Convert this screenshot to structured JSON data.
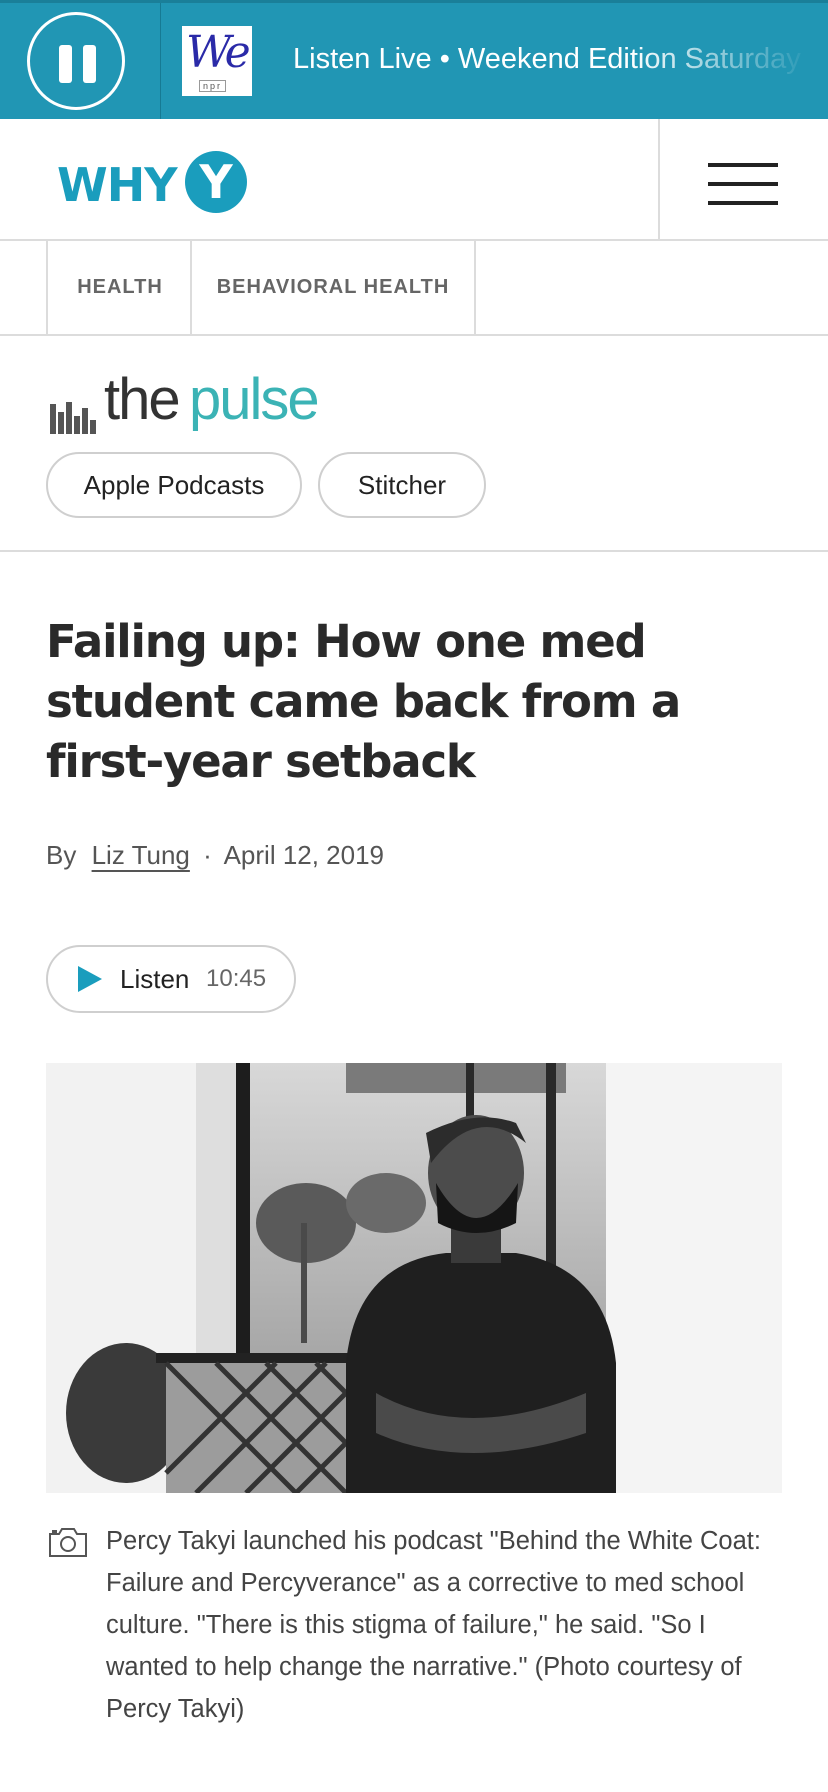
{
  "player": {
    "station_logo": "We",
    "station_sub": "npr",
    "live_text": "Listen Live • Weekend Edition Saturday",
    "pause_icon": "pause-icon"
  },
  "header": {
    "logo_text": "WHY",
    "logo_circle_letter": "Y",
    "menu_icon": "hamburger-menu-icon",
    "brand_color": "#1a9dbd"
  },
  "breadcrumb": {
    "items": [
      {
        "label": "HEALTH"
      },
      {
        "label": "BEHAVIORAL HEALTH"
      }
    ]
  },
  "show": {
    "logo_the": "the",
    "logo_pulse": "pulse",
    "buttons": [
      {
        "label": "Apple Podcasts"
      },
      {
        "label": "Stitcher"
      }
    ]
  },
  "article": {
    "headline": "Failing up: How one med student came back from a first-year setback",
    "by_label": "By",
    "author": "Liz Tung",
    "separator": "·",
    "date": "April 12, 2019",
    "listen_label": "Listen",
    "listen_duration": "10:45",
    "photo_caption": "Percy Takyi launched his podcast \"Behind the White Coat: Failure and Percyverance\" as a corrective to med school culture. \"There is this stigma of failure,\" he said. \"So I wanted to help change the narrative.\" (Photo courtesy of Percy Takyi)",
    "caption_icon": "camera-icon"
  }
}
